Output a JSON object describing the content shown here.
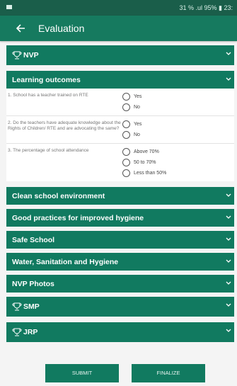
{
  "status": {
    "right_text": "31 % .ul 95% ▮ 23:"
  },
  "appbar": {
    "title": "Evaluation"
  },
  "sections": {
    "nvp": "NVP",
    "learning": "Learning outcomes",
    "clean": "Clean school environment",
    "hygiene": "Good practices for improved hygiene",
    "safe": "Safe School",
    "wash": "Water, Sanitation and Hygiene",
    "photos": "NVP Photos",
    "smp": "SMP",
    "jrp": "JRP"
  },
  "questions": [
    {
      "text": "1. School has a teacher trained on RTE",
      "options": [
        "Yes",
        "No"
      ]
    },
    {
      "text": "2. Do the teachers have adequate knowledge about the Rights of Children/ RTE and are advocating the same?",
      "options": [
        "Yes",
        "No"
      ]
    },
    {
      "text": "3. The percentage of school attendance",
      "options": [
        "Above 70%",
        "50 to 70%",
        "Less than 50%"
      ]
    }
  ],
  "buttons": {
    "submit": "SUBMIT",
    "finalize": "FINALIZE"
  },
  "colors": {
    "primary": "#117a60",
    "appbar": "#167a5f",
    "statusbar": "#1a5e4a",
    "background": "#f4f4f4"
  }
}
